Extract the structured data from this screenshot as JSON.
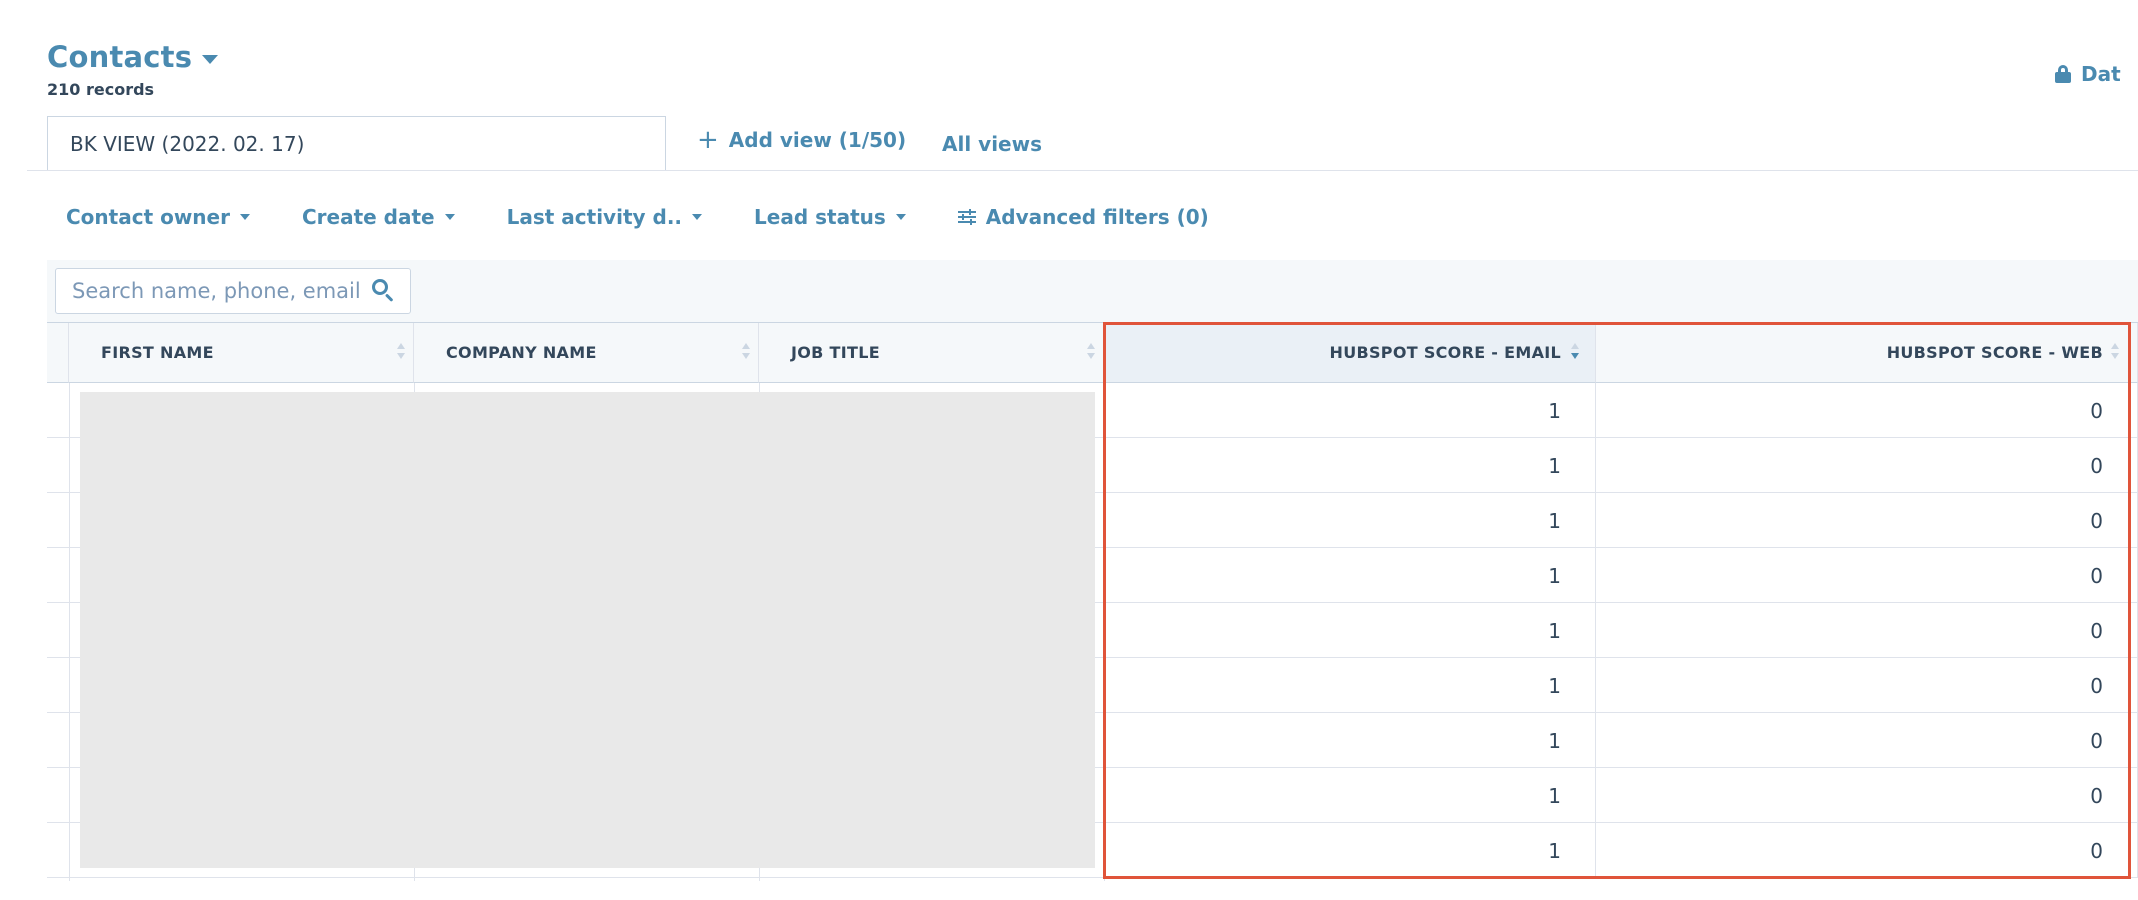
{
  "header": {
    "title": "Contacts",
    "records": "210 records",
    "top_right_label": "Dat"
  },
  "views": {
    "active_view": "BK VIEW (2022. 02. 17)",
    "add_view": "Add view (1/50)",
    "all_views": "All views"
  },
  "filters": {
    "contact_owner": "Contact owner",
    "create_date": "Create date",
    "last_activity": "Last activity d..",
    "lead_status": "Lead status",
    "advanced": "Advanced filters (0)"
  },
  "search": {
    "placeholder": "Search name, phone, email"
  },
  "table": {
    "columns": [
      "FIRST NAME",
      "COMPANY NAME",
      "JOB TITLE",
      "HUBSPOT SCORE - EMAIL",
      "HUBSPOT SCORE - WEB"
    ],
    "rows": [
      {
        "email": "1",
        "web": "0"
      },
      {
        "email": "1",
        "web": "0"
      },
      {
        "email": "1",
        "web": "0"
      },
      {
        "email": "1",
        "web": "0"
      },
      {
        "email": "1",
        "web": "0"
      },
      {
        "email": "1",
        "web": "0"
      },
      {
        "email": "1",
        "web": "0"
      },
      {
        "email": "1",
        "web": "0"
      },
      {
        "email": "1",
        "web": "0"
      }
    ]
  },
  "colors": {
    "accent": "#4a8ab0",
    "highlight_border": "#e0543a",
    "text": "#33475b"
  }
}
